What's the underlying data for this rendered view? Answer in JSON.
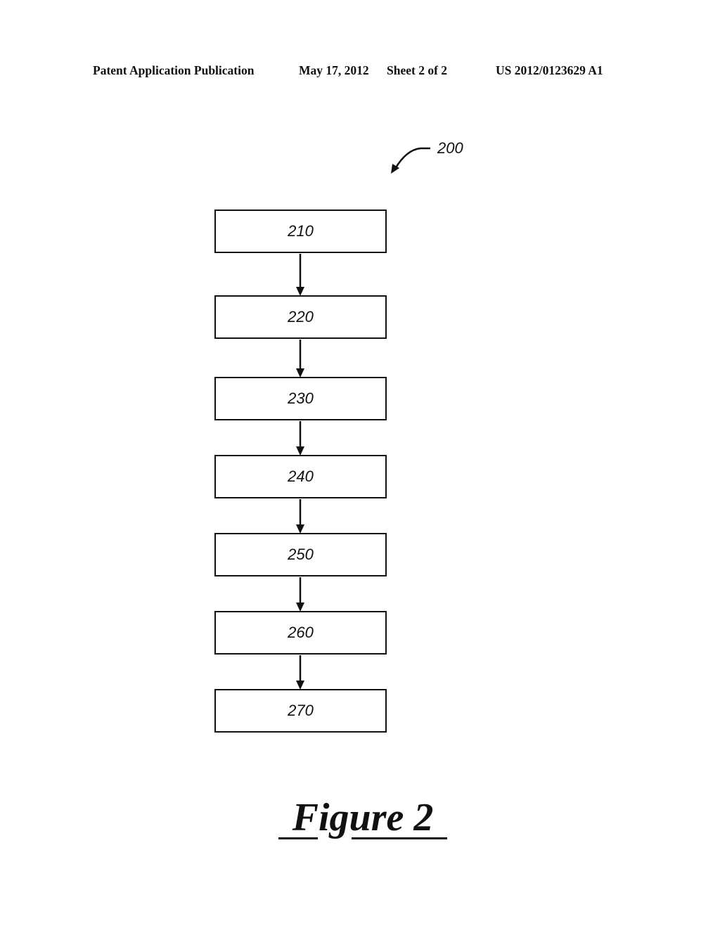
{
  "header": {
    "publication": "Patent Application Publication",
    "date": "May 17, 2012",
    "sheet": "Sheet 2 of 2",
    "number": "US 2012/0123629 A1"
  },
  "diagram": {
    "reference": "200",
    "steps": [
      {
        "label": "210"
      },
      {
        "label": "220"
      },
      {
        "label": "230"
      },
      {
        "label": "240"
      },
      {
        "label": "250"
      },
      {
        "label": "260"
      },
      {
        "label": "270"
      }
    ],
    "flow": "top-to-bottom"
  },
  "figure": {
    "title": "Figure 2"
  }
}
